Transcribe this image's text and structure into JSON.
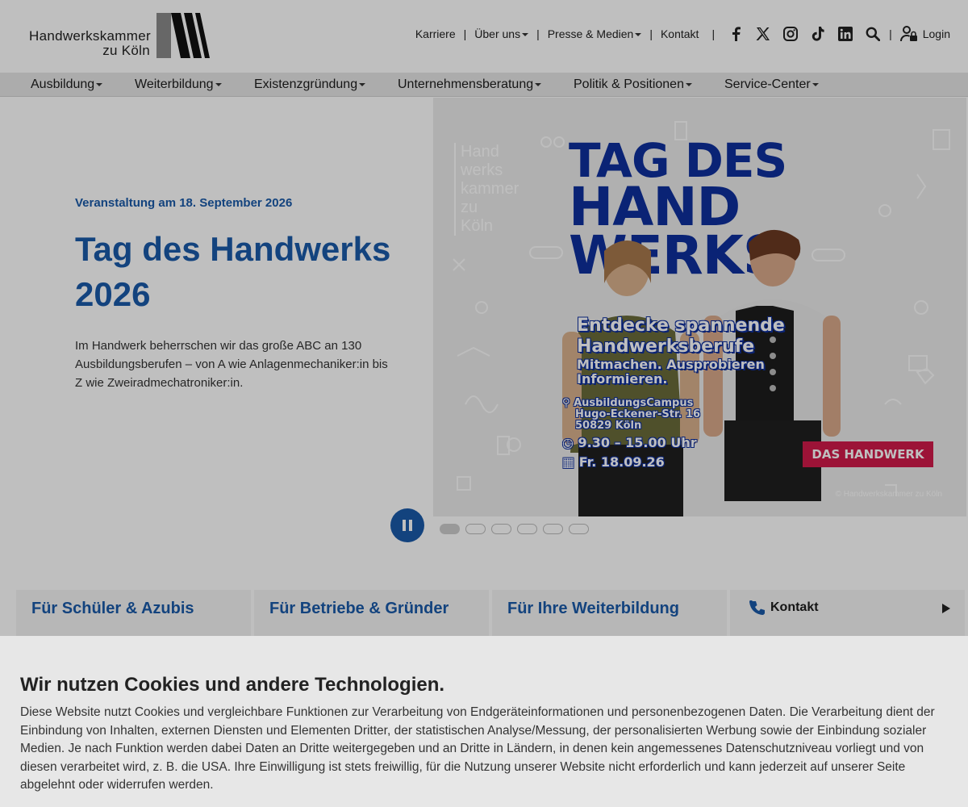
{
  "header": {
    "logo_line1": "Handwerkskammer",
    "logo_line2": "zu Köln",
    "topnav": [
      {
        "label": "Karriere"
      },
      {
        "label": "Über uns"
      },
      {
        "label": "Presse & Medien"
      },
      {
        "label": "Kontakt"
      }
    ],
    "social_icons": [
      "facebook-icon",
      "x-icon",
      "instagram-icon",
      "tiktok-icon",
      "linkedin-icon"
    ],
    "login_label": "Login"
  },
  "mainnav": [
    {
      "label": "Ausbildung"
    },
    {
      "label": "Weiterbildung"
    },
    {
      "label": "Existenzgründung"
    },
    {
      "label": "Unternehmensberatung"
    },
    {
      "label": "Politik & Positionen"
    },
    {
      "label": "Service-Center"
    }
  ],
  "hero": {
    "date": "Veranstaltung am 18. September 2026",
    "title": "Tag des Handwerks 2026",
    "description": "Im Handwerk beherrschen wir das große ABC an 130 Ausbildungsberufen – von A wie Anlagenmechaniker:in bis Z wie Zweiradmechatroniker:in.",
    "poster": {
      "title_line1": "TAG DES",
      "title_line2": "HAND",
      "title_line3": "WERKS",
      "hkk_lines": [
        "Hand",
        "werks",
        "kammer",
        "zu",
        "Köln"
      ],
      "sub1": "Entdecke spannende",
      "sub2": "Handwerksberufe",
      "sub3": "Mitmachen. Ausprobieren",
      "sub4": "Informieren.",
      "location1": "AusbildungsCampus",
      "location2": "Hugo-Eckener-Str. 16",
      "location3": "50829 Köln",
      "time": "9.30 – 15.00 Uhr",
      "day": "Fr. 18.09.26",
      "brand": "DAS HANDWERK",
      "copyright": "© Handwerkskammer zu Köln"
    },
    "slides_total": 6,
    "active_slide": 1
  },
  "cards": [
    {
      "label": "Für Schüler & Azubis"
    },
    {
      "label": "Für Betriebe & Gründer"
    },
    {
      "label": "Für Ihre Weiterbildung"
    },
    {
      "label": "Kontakt"
    }
  ],
  "cookie": {
    "title": "Wir nutzen Cookies und andere Technologien.",
    "text": "Diese Website nutzt Cookies und vergleichbare Funktionen zur Verarbeitung von Endgeräteinformationen und personenbezogenen Daten. Die Verarbeitung dient der Einbindung von Inhalten, externen Diensten und Elementen Dritter, der statistischen Analyse/Messung, der personalisierten Werbung sowie der Einbindung sozialer Medien. Je nach Funktion werden dabei Daten an Dritte weitergegeben und an Dritte in Ländern, in denen kein angemessenes Datenschutzniveau vorliegt und von diesen verarbeitet wird, z. B. die USA. Ihre Einwilligung ist stets freiwillig, für die Nutzung unserer Website nicht erforderlich und kann jederzeit auf unserer Seite abgelehnt oder widerrufen werden."
  },
  "colors": {
    "brand_blue": "#1a5aa8",
    "poster_blue": "#0e2f9c",
    "handwerk_red": "#d11a4a"
  }
}
